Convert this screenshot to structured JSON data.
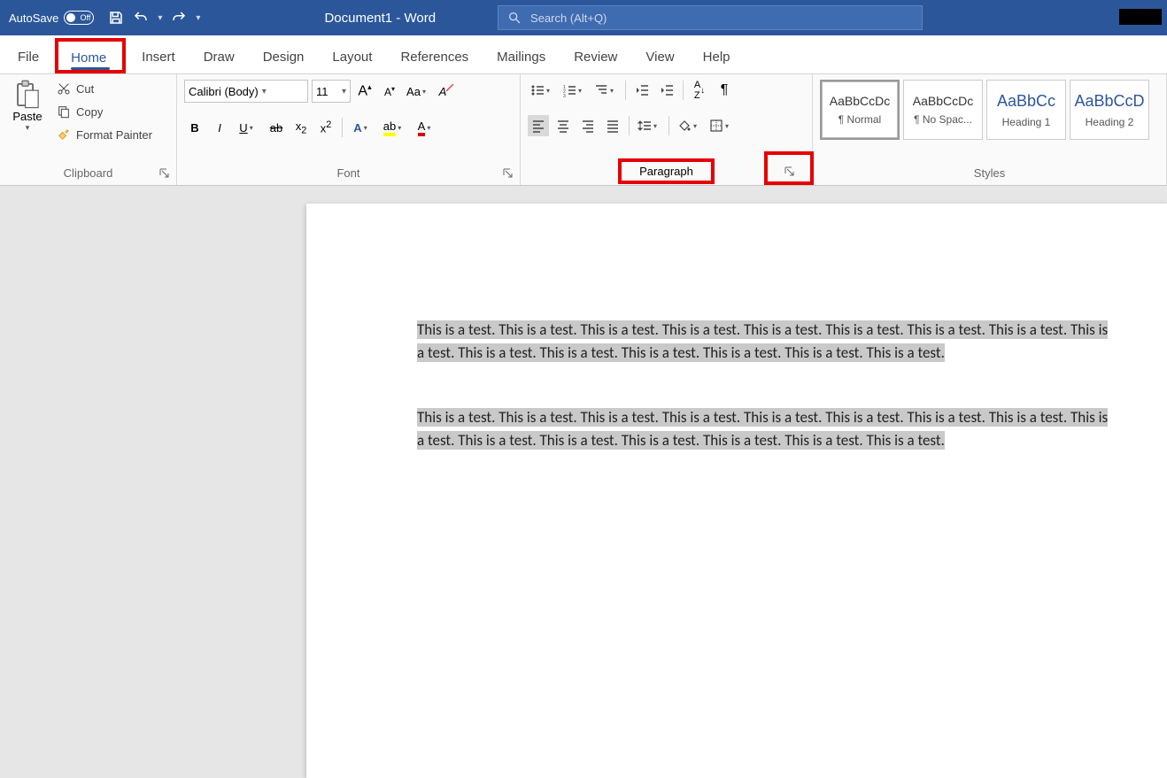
{
  "titlebar": {
    "autosave_label": "AutoSave",
    "autosave_state": "Off",
    "doc_title": "Document1 - Word",
    "search_placeholder": "Search (Alt+Q)"
  },
  "tabs": {
    "file": "File",
    "home": "Home",
    "insert": "Insert",
    "draw": "Draw",
    "design": "Design",
    "layout": "Layout",
    "references": "References",
    "mailings": "Mailings",
    "review": "Review",
    "view": "View",
    "help": "Help"
  },
  "clipboard": {
    "paste": "Paste",
    "cut": "Cut",
    "copy": "Copy",
    "format_painter": "Format Painter",
    "label": "Clipboard"
  },
  "font": {
    "name": "Calibri (Body)",
    "size": "11",
    "label": "Font"
  },
  "paragraph": {
    "label": "Paragraph"
  },
  "styles": {
    "label": "Styles",
    "items": [
      {
        "sample": "AaBbCcDc",
        "name": "¶ Normal",
        "blue": false
      },
      {
        "sample": "AaBbCcDc",
        "name": "¶ No Spac...",
        "blue": false
      },
      {
        "sample": "AaBbCc",
        "name": "Heading 1",
        "blue": true
      },
      {
        "sample": "AaBbCcD",
        "name": "Heading 2",
        "blue": true
      }
    ]
  },
  "document": {
    "p1": "This is a test. This is a test. This is a test. This is a test. This is a test. This is a test. This is a test. This is a test. This is a test. This is a test. This is a test. This is a test. This is a test. This is a test. This is a test.",
    "p2": "This is a test. This is a test. This is a test. This is a test. This is a test. This is a test. This is a test. This is a test. This is a test. This is a test. This is a test. This is a test. This is a test. This is a test. This is a test."
  }
}
